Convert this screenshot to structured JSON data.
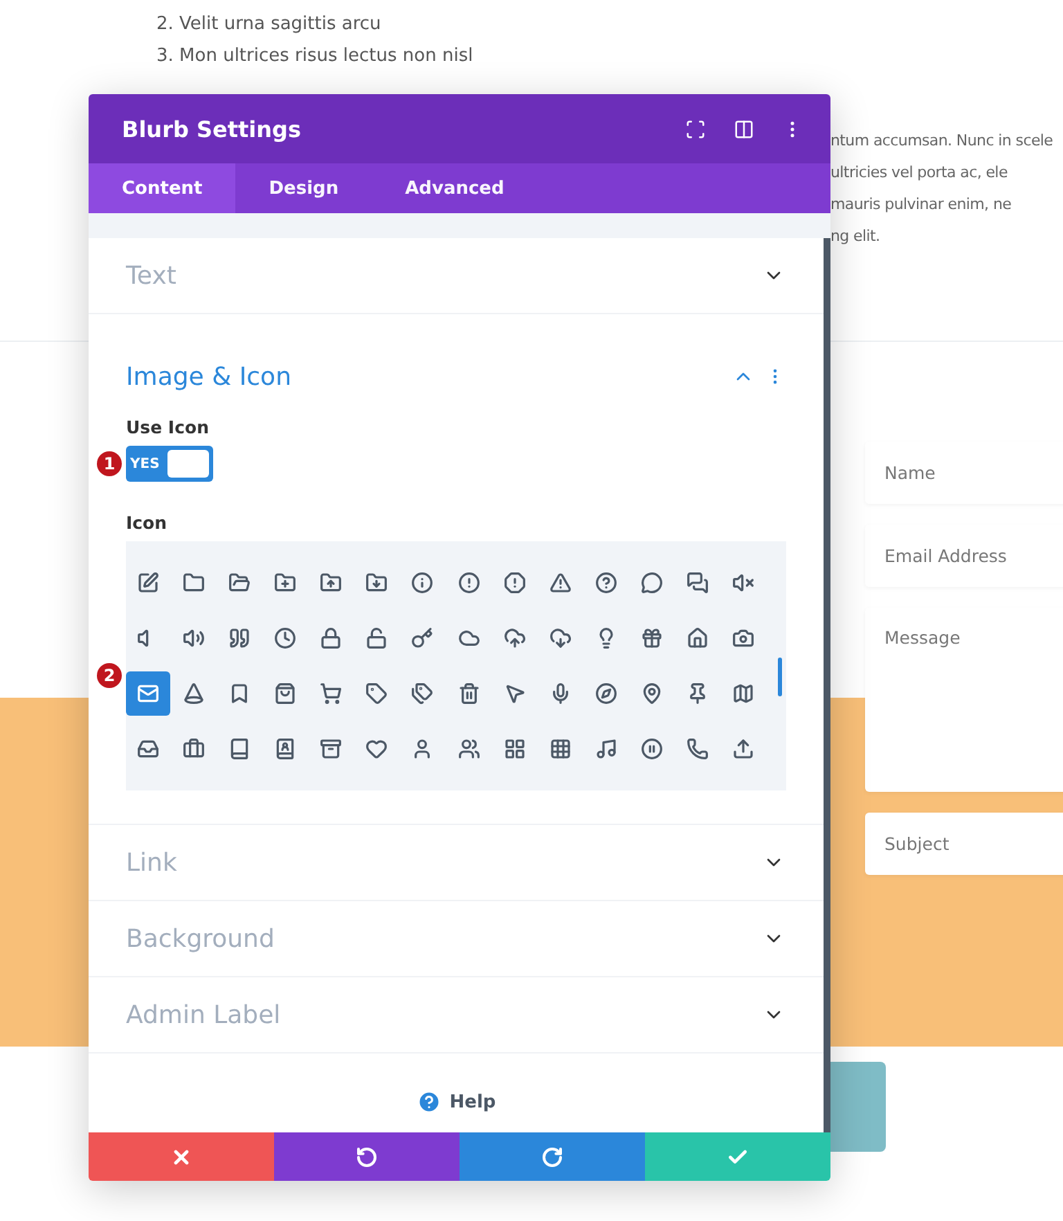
{
  "page": {
    "list_items": [
      "2. Velit urna sagittis arcu",
      "3. Mon ultrices risus lectus non nisl"
    ],
    "paragraph_lines": [
      "ntum accumsan. Nunc in scele",
      "ultricies vel porta ac, ele",
      "mauris pulvinar enim, ne",
      "ng elit."
    ],
    "form_fields": [
      {
        "placeholder": "Name",
        "kind": "input"
      },
      {
        "placeholder": "Email Address",
        "kind": "input"
      },
      {
        "placeholder": "Message",
        "kind": "textarea"
      },
      {
        "placeholder": "Subject",
        "kind": "input"
      }
    ]
  },
  "modal": {
    "title": "Blurb Settings",
    "tabs": [
      {
        "label": "Content",
        "selected": true
      },
      {
        "label": "Design",
        "selected": false
      },
      {
        "label": "Advanced",
        "selected": false
      }
    ],
    "sections": [
      {
        "title": "Text",
        "expanded": false
      },
      {
        "title": "Image & Icon",
        "expanded": true
      },
      {
        "title": "Link",
        "expanded": false
      },
      {
        "title": "Background",
        "expanded": false
      },
      {
        "title": "Admin Label",
        "expanded": false
      }
    ],
    "use_icon": {
      "label": "Use Icon",
      "on": true,
      "text": "YES",
      "marker": "1"
    },
    "icon_picker": {
      "label": "Icon",
      "marker": "2",
      "icons": [
        {
          "selected": false
        },
        {
          "selected": false
        },
        {
          "selected": false
        },
        {
          "selected": false
        },
        {
          "selected": false
        },
        {
          "selected": false
        },
        {
          "selected": false
        },
        {
          "selected": false
        },
        {
          "selected": false
        },
        {
          "selected": false
        },
        {
          "selected": false
        },
        {
          "selected": false
        },
        {
          "selected": false
        },
        {
          "selected": false
        },
        {
          "selected": false
        },
        {
          "selected": false
        },
        {
          "selected": false
        },
        {
          "selected": false
        },
        {
          "selected": false
        },
        {
          "selected": false
        },
        {
          "selected": false
        },
        {
          "selected": false
        },
        {
          "selected": false
        },
        {
          "selected": false
        },
        {
          "selected": false
        },
        {
          "selected": false
        },
        {
          "selected": false
        },
        {
          "selected": false
        },
        {
          "selected": true
        },
        {
          "selected": false
        },
        {
          "selected": false
        },
        {
          "selected": false
        },
        {
          "selected": false
        },
        {
          "selected": false
        },
        {
          "selected": false
        },
        {
          "selected": false
        },
        {
          "selected": false
        },
        {
          "selected": false
        },
        {
          "selected": false
        },
        {
          "selected": false
        },
        {
          "selected": false
        },
        {
          "selected": false
        },
        {
          "selected": false
        },
        {
          "selected": false
        },
        {
          "selected": false
        },
        {
          "selected": false
        },
        {
          "selected": false
        },
        {
          "selected": false
        },
        {
          "selected": false
        },
        {
          "selected": false
        },
        {
          "selected": false
        },
        {
          "selected": false
        },
        {
          "selected": false
        },
        {
          "selected": false
        },
        {
          "selected": false
        },
        {
          "selected": false
        }
      ]
    },
    "help": "Help"
  }
}
